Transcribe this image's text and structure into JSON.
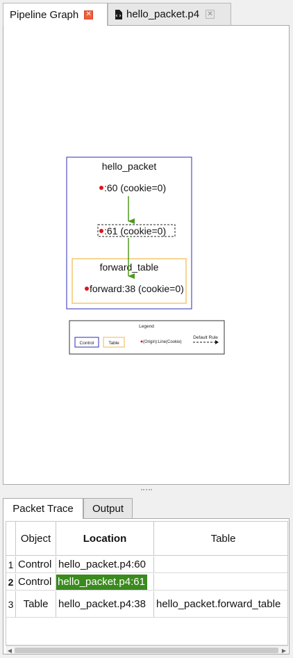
{
  "editor_tabs": [
    {
      "label": "Pipeline Graph",
      "close": "✕"
    },
    {
      "label": "hello_packet.p4",
      "close": "✕"
    }
  ],
  "graph": {
    "control_title": "hello_packet",
    "node1": ":60 (cookie=0)",
    "node2": ":61 (cookie=0)",
    "table_title": "forward_table",
    "node3": "forward:38 (cookie=0)",
    "legend": {
      "title": "Legend",
      "control": "Control",
      "table": "Table",
      "origin": "(Origin):Line(Cookie)",
      "default_rule": "Default Rule"
    },
    "colors": {
      "dot": "#e0141b",
      "arrow": "#4f9a1f",
      "control_border": "#2b2bb8",
      "table_border": "#f2b74a"
    }
  },
  "bottom_tabs": [
    {
      "label": "Packet Trace"
    },
    {
      "label": "Output"
    }
  ],
  "trace_table": {
    "headers": [
      "Object",
      "Location",
      "Table"
    ],
    "rows": [
      {
        "num": "1",
        "object": "Control",
        "location": "hello_packet.p4:60",
        "table": ""
      },
      {
        "num": "2",
        "object": "Control",
        "location": "hello_packet.p4:61",
        "table": ""
      },
      {
        "num": "3",
        "object": "Table",
        "location": "hello_packet.p4:38",
        "table": "hello_packet.forward_table"
      }
    ],
    "highlight_color": "#3a8a1e"
  }
}
